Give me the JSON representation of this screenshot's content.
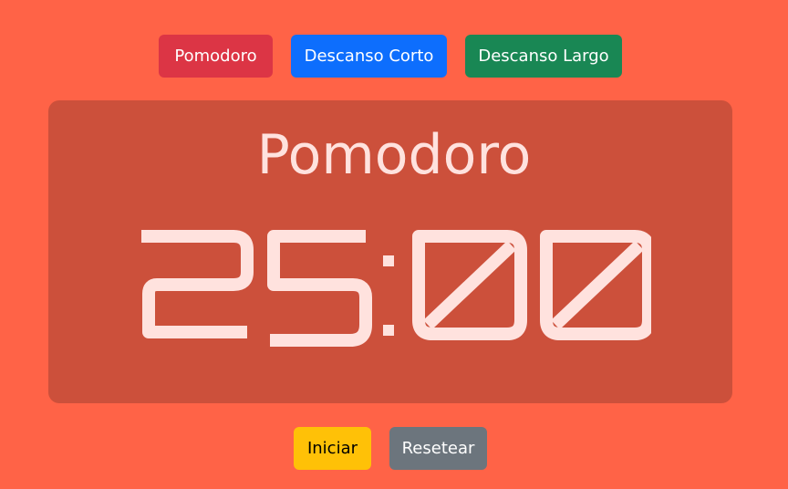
{
  "modes": {
    "pomodoro": "Pomodoro",
    "short_break": "Descanso Corto",
    "long_break": "Descanso Largo"
  },
  "timer": {
    "title": "Pomodoro",
    "time": "25:00"
  },
  "controls": {
    "start": "Iniciar",
    "reset": "Resetear"
  },
  "colors": {
    "page_background": "#ff6347",
    "timer_card": "#cc503b",
    "timer_text": "#ffe2de",
    "pomodoro_button": "#dc3545",
    "short_break_button": "#0d6efd",
    "long_break_button": "#198754",
    "start_button": "#ffc107",
    "reset_button": "#6c757d"
  }
}
